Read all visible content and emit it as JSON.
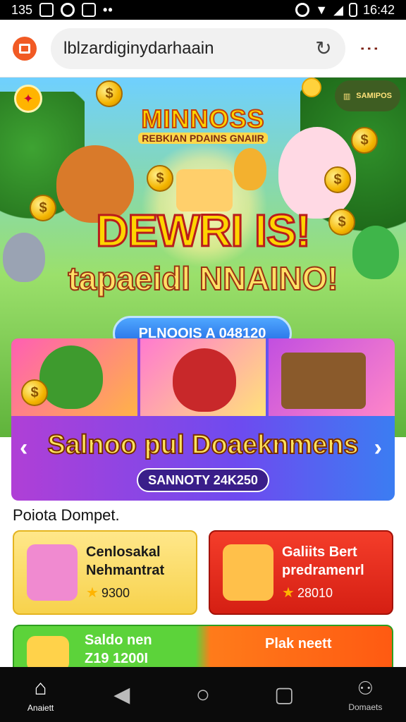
{
  "status_bar": {
    "time_left": "135",
    "time_right": "16:42"
  },
  "browser": {
    "url_text": "lblzardiginуdarhaain"
  },
  "hero": {
    "title_top": "MINNOSS",
    "subtitle_small": "REBKIAN PDAINS GNAIIR",
    "title_main": "DEWRI IS!",
    "title_sub": "tapaeidl NNAINO!",
    "promo_button": "PLNOOIS A 048120",
    "shop_label": "SAMIPOS"
  },
  "carousel": {
    "title": "Salnoo pul Doaeknmens",
    "badge": "SANNOTY 24K250"
  },
  "section_label": "Poiota Dompet.",
  "tiles": [
    {
      "line1": "Cenlosakal",
      "line2": "Nehmantrat",
      "price": "9300"
    },
    {
      "line1": "Galiits Bert",
      "line2": "predramenrl",
      "price": "28010"
    }
  ],
  "wide_tile": {
    "line1": "Saldo nen",
    "line2": "Z19 1200I",
    "right_label": "Plak neett"
  },
  "nav": {
    "home_label": "Anaiett",
    "contacts_label": "Domaets"
  },
  "colors": {
    "accent_orange": "#f15a24",
    "hero_green": "#5fb33b",
    "nav_bg": "#0b0b0b"
  },
  "icons": [
    "home-icon",
    "back-icon",
    "home-circle-icon",
    "recents-icon",
    "contacts-icon",
    "reload-icon",
    "menu-dots-icon"
  ]
}
